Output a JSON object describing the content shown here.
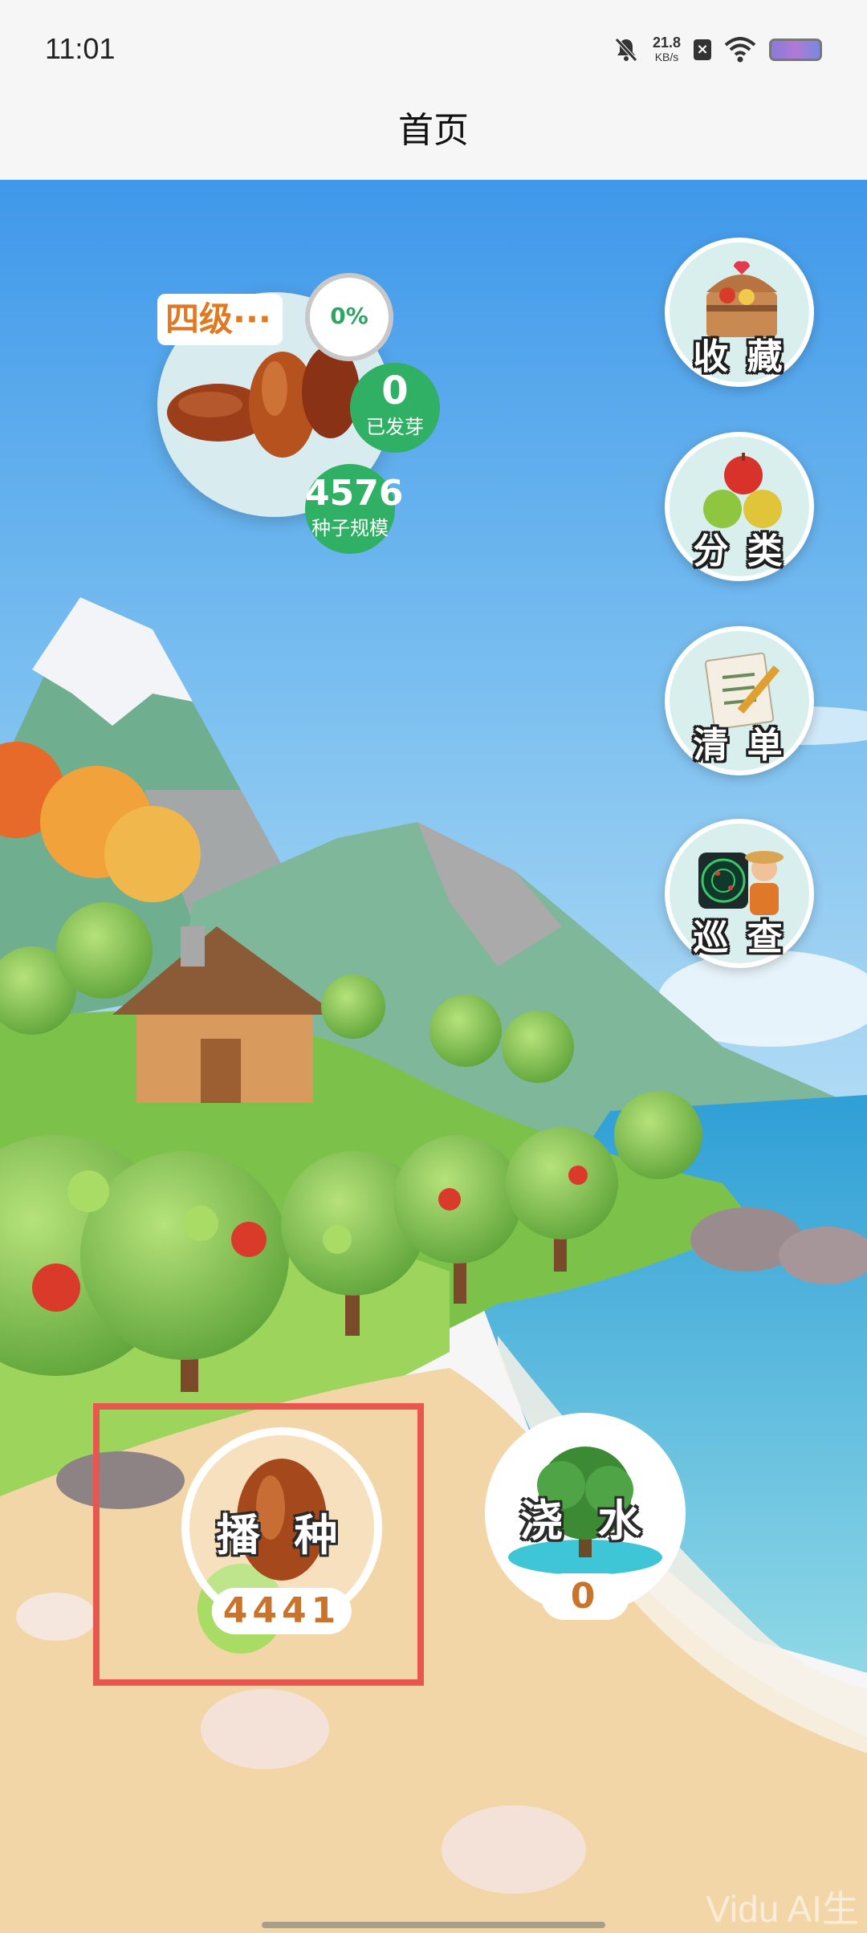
{
  "status_bar": {
    "time": "11:01",
    "net_speed": "21.8",
    "net_unit": "KB/s",
    "icons": [
      "bell-off-icon",
      "sim-x-icon",
      "wifi-icon",
      "battery-icon"
    ]
  },
  "header": {
    "title": "首页"
  },
  "seed_panel": {
    "level": "四级···",
    "progress": "0%",
    "sprouted_value": "0",
    "sprouted_label": "已发芽",
    "scale_value": "4576",
    "scale_label": "种子规模"
  },
  "side_menu": {
    "items": [
      {
        "label": "收 藏",
        "icon": "treasure-chest-icon"
      },
      {
        "label": "分 类",
        "icon": "apples-icon"
      },
      {
        "label": "清 单",
        "icon": "checklist-icon"
      },
      {
        "label": "巡 查",
        "icon": "radar-inspector-icon"
      }
    ]
  },
  "actions": {
    "sow_label": "播 种",
    "sow_count": "4441",
    "water_label": "浇 水",
    "water_count": "0"
  },
  "watermark": "Vidu AI生",
  "colors": {
    "highlight": "#e85650",
    "badge_green": "#2fb064",
    "level_orange": "#e07a22"
  }
}
